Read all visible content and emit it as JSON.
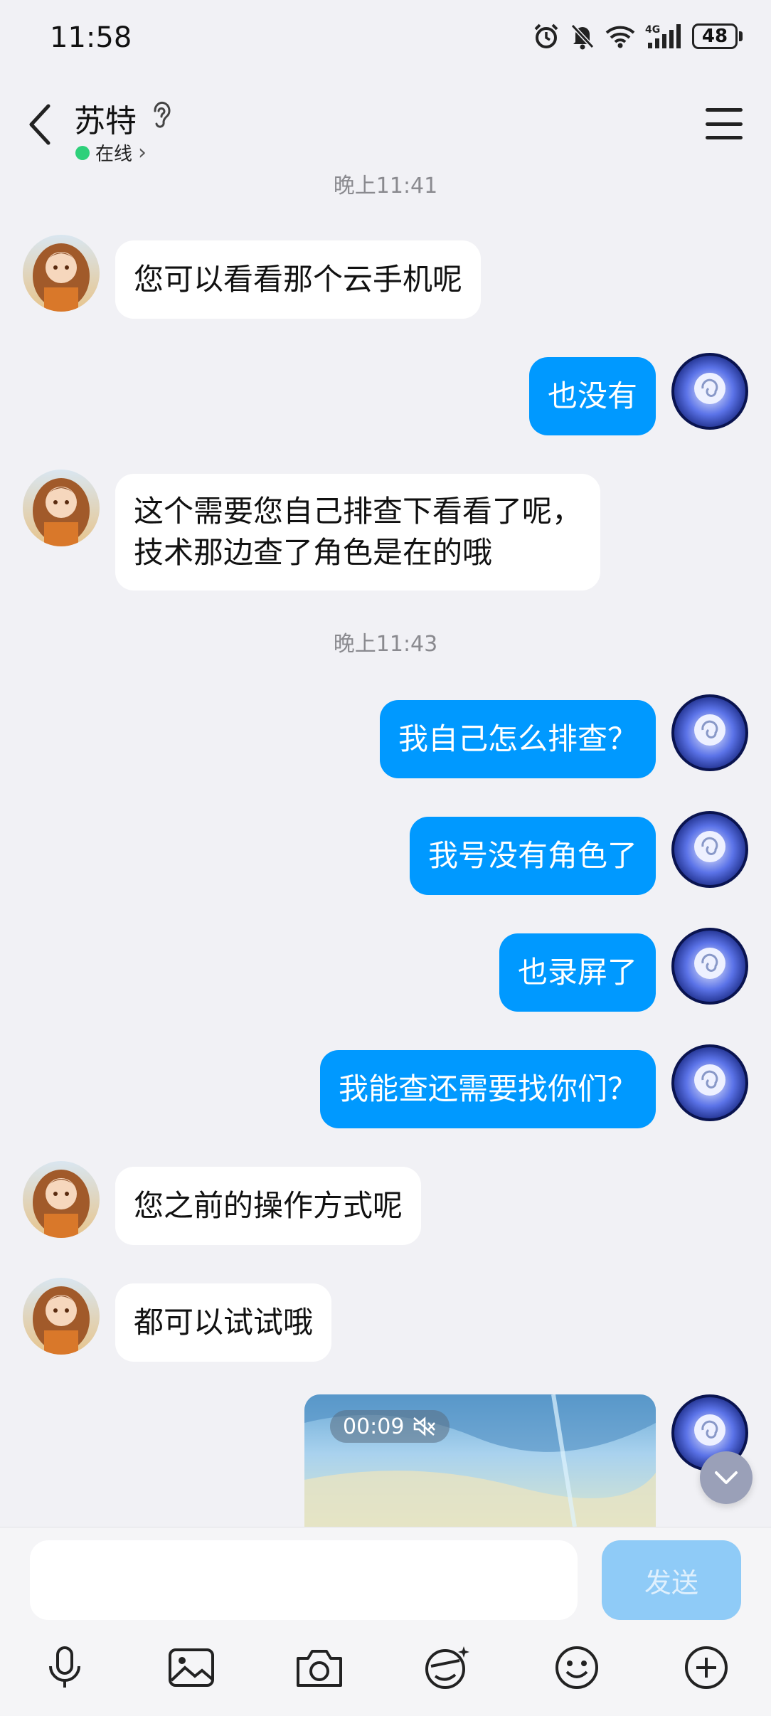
{
  "status_bar": {
    "time": "11:58",
    "network": "4G",
    "battery": "48"
  },
  "header": {
    "name": "苏特",
    "status": "在线",
    "status_chevron": "›"
  },
  "messages": [
    {
      "type": "timestamp",
      "text": "晚上11:41"
    },
    {
      "side": "left",
      "text": "您可以看看那个云手机呢"
    },
    {
      "side": "right",
      "text": "也没有"
    },
    {
      "side": "left",
      "lines": [
        "这个需要您自己排查下看看了呢，",
        "技术那边查了角色是在的哦"
      ]
    },
    {
      "type": "timestamp",
      "text": "晚上11:43"
    },
    {
      "side": "right",
      "text": "我自己怎么排查？"
    },
    {
      "side": "right",
      "text": "我号没有角色了"
    },
    {
      "side": "right",
      "text": "也录屏了"
    },
    {
      "side": "right",
      "text": "我能查还需要找你们？"
    },
    {
      "side": "left",
      "text": "您之前的操作方式呢"
    },
    {
      "side": "left",
      "text": "都可以试试哦"
    },
    {
      "side": "right",
      "type": "video",
      "duration": "00:09",
      "muted": true
    }
  ],
  "input": {
    "placeholder": "",
    "send_label": "发送"
  },
  "toolbar": [
    "mic-icon",
    "image-icon",
    "camera-icon",
    "sticker-icon",
    "emoji-icon",
    "plus-icon"
  ],
  "colors": {
    "accent": "#0099ff",
    "online": "#2ed07a",
    "send_disabled": "#8fcbf7"
  }
}
